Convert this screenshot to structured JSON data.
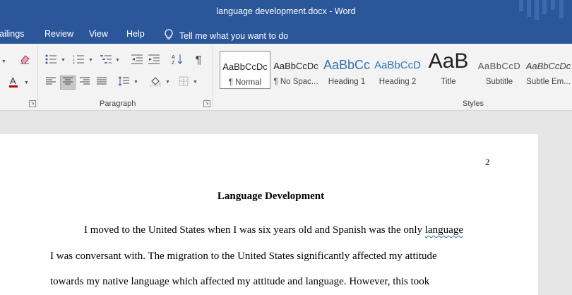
{
  "window": {
    "title": "language development.docx  -  Word"
  },
  "tabs": [
    "ailings",
    "Review",
    "View",
    "Help"
  ],
  "tell_me": "Tell me what you want to do",
  "ribbon": {
    "groups": {
      "paragraph": "Paragraph",
      "styles": "Styles"
    },
    "styles": [
      {
        "sample": "AaBbCcDc",
        "name": "¶ Normal",
        "active": true
      },
      {
        "sample": "AaBbCcDc",
        "name": "¶ No Spac..."
      },
      {
        "sample": "AaBbCc",
        "name": "Heading 1"
      },
      {
        "sample": "AaBbCcD",
        "name": "Heading 2"
      },
      {
        "sample": "AaB",
        "name": "Title"
      },
      {
        "sample": "AaBbCcD",
        "name": "Subtitle"
      },
      {
        "sample": "AaBbCcDc",
        "name": "Subtle Em..."
      }
    ]
  },
  "colors": {
    "titlebar": "#2b579a",
    "font_color": "#c00000",
    "heading1": "#2e74b5",
    "squiggle": "#2c6fc1"
  },
  "document": {
    "page_number": "2",
    "heading": "Language Development",
    "line1_before": "I moved to the United States when I was six years old and Spanish was the only ",
    "line1_flagged": "language",
    "line2": "I was conversant with. The migration to the United States significantly affected my attitude",
    "line3": "towards my native language which affected my attitude and language. However, this took"
  }
}
